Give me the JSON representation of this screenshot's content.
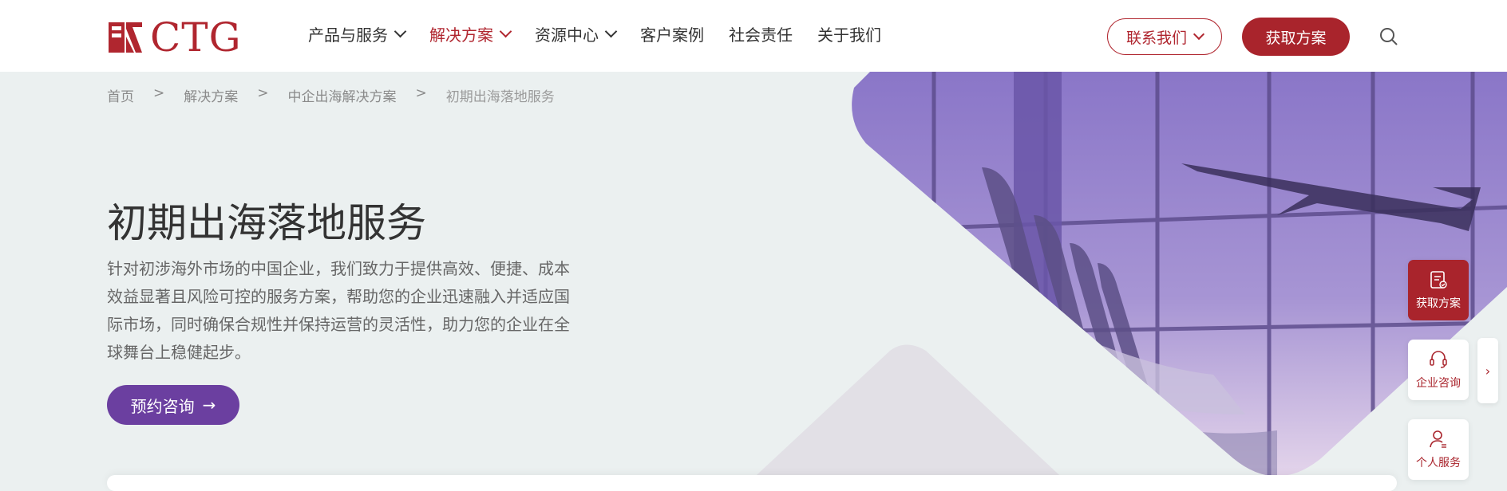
{
  "header": {
    "logo_text": "CTG",
    "nav": [
      {
        "label": "产品与服务",
        "has_dropdown": true,
        "active": false
      },
      {
        "label": "解决方案",
        "has_dropdown": true,
        "active": true
      },
      {
        "label": "资源中心",
        "has_dropdown": true,
        "active": false
      },
      {
        "label": "客户案例",
        "has_dropdown": false,
        "active": false
      },
      {
        "label": "社会责任",
        "has_dropdown": false,
        "active": false
      },
      {
        "label": "关于我们",
        "has_dropdown": false,
        "active": false
      }
    ],
    "contact_label": "联系我们",
    "get_plan_label": "获取方案",
    "search_icon": "search-icon"
  },
  "breadcrumb": {
    "items": [
      "首页",
      "解决方案",
      "中企出海解决方案",
      "初期出海落地服务"
    ],
    "separator": ">"
  },
  "hero": {
    "title": "初期出海落地服务",
    "description": "针对初涉海外市场的中国企业，我们致力于提供高效、便捷、成本效益显著且风险可控的服务方案，帮助您的企业迅速融入并适应国际市场，同时确保合规性并保持运营的灵活性，助力您的企业在全球舞台上稳健起步。",
    "cta_label": "预约咨询",
    "cta_arrow": "→"
  },
  "floating": {
    "items": [
      {
        "label": "获取方案",
        "icon": "clipboard-icon"
      },
      {
        "label": "企业咨询",
        "icon": "headset-icon"
      },
      {
        "label": "个人服务",
        "icon": "person-icon"
      }
    ],
    "expand_arrow": "›"
  },
  "colors": {
    "brand_red": "#a9242c",
    "cta_purple": "#6b3fa0",
    "hero_bg": "#ebf0f0"
  }
}
